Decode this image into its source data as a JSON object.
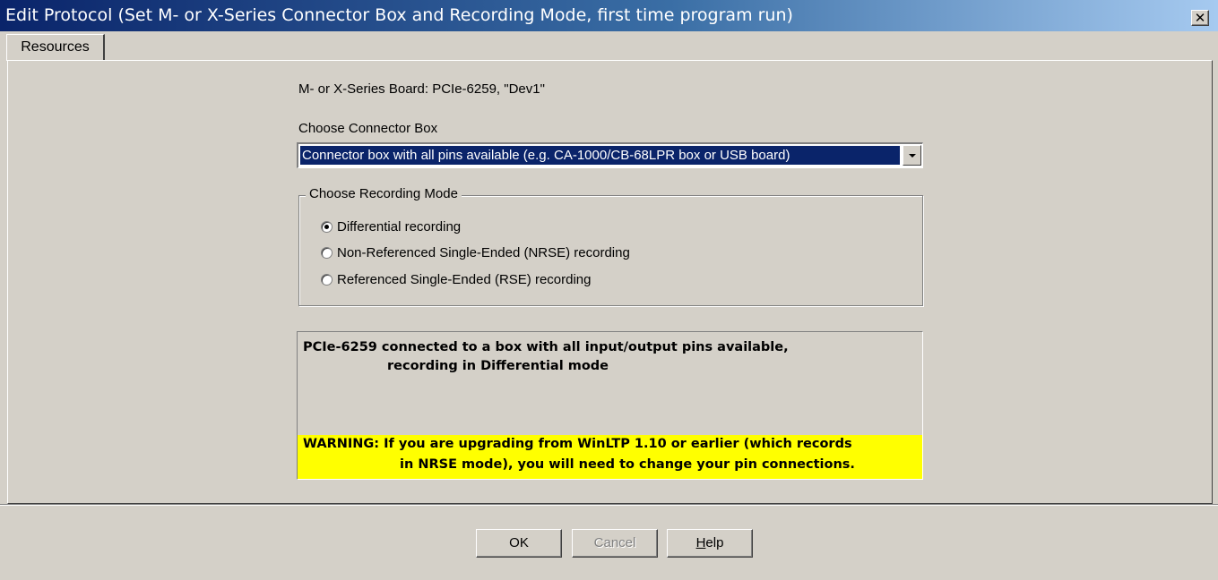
{
  "window": {
    "title": "Edit Protocol  (Set M- or X-Series Connector Box and Recording Mode, first time program run)",
    "close_glyph": "✕"
  },
  "tabs": [
    {
      "label": "Resources"
    }
  ],
  "board_info": "M- or X-Series Board:  PCIe-6259,  \"Dev1\"",
  "connector": {
    "label": "Choose Connector Box",
    "selected": "Connector box with all pins available (e.g. CA-1000/CB-68LPR box or USB board)"
  },
  "recording_mode": {
    "legend": "Choose Recording Mode",
    "options": [
      {
        "label": "Differential recording",
        "checked": true
      },
      {
        "label": "Non-Referenced Single-Ended (NRSE) recording",
        "checked": false
      },
      {
        "label": "Referenced Single-Ended (RSE) recording",
        "checked": false
      }
    ]
  },
  "summary": {
    "line1": "PCIe-6259 connected to a box with all input/output pins available,",
    "line2": "recording in Differential mode"
  },
  "warning": {
    "line1": "WARNING: If you are upgrading from WinLTP 1.10 or earlier (which records",
    "line2": "in NRSE mode), you will need to change your pin connections.",
    "color": "#ffff00"
  },
  "buttons": {
    "ok": "OK",
    "cancel": "Cancel",
    "help_first": "H",
    "help_rest": "elp"
  },
  "colors": {
    "title_bar": "#0a246a",
    "face": "#d4d0c8",
    "selection": "#0a246a"
  }
}
